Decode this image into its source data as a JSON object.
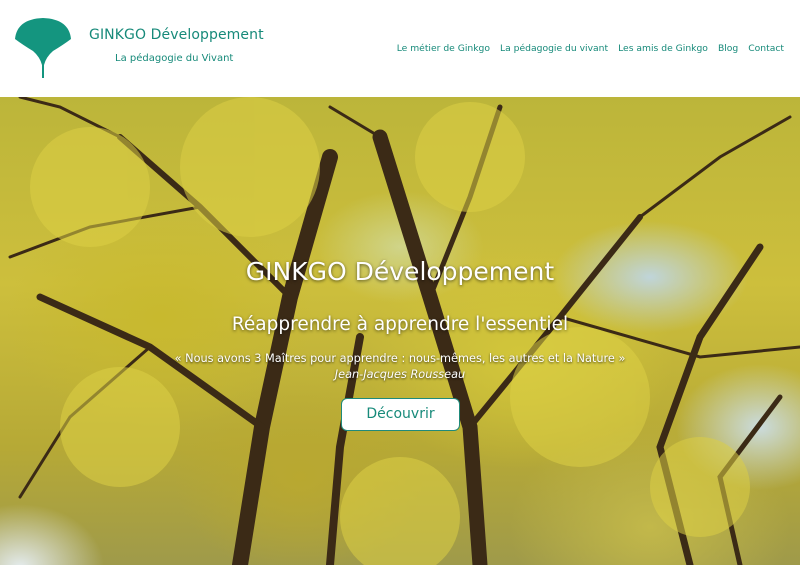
{
  "header": {
    "brand_name": "GINKGO Développement",
    "brand_tagline": "La pédagogie du Vivant",
    "logo_icon": "ginkgo-leaf-icon",
    "brand_color": "#178a7a"
  },
  "nav": {
    "items": [
      {
        "label": "Le métier de Ginkgo"
      },
      {
        "label": "La pédagogie du vivant"
      },
      {
        "label": "Les amis de Ginkgo"
      },
      {
        "label": "Blog"
      },
      {
        "label": "Contact"
      }
    ]
  },
  "hero": {
    "title": "GINKGO Développement",
    "subtitle": "Réapprendre à apprendre l'essentiel",
    "quote": "« Nous avons 3 Maîtres pour apprendre : nous-mêmes, les autres et la Nature »",
    "author": "Jean-Jacques Rousseau",
    "button_label": "Découvrir"
  }
}
